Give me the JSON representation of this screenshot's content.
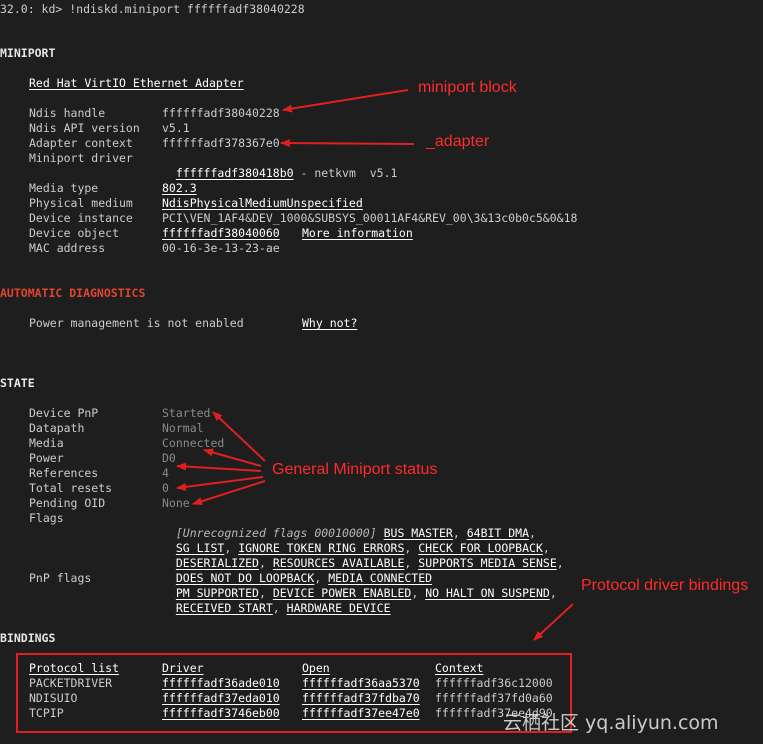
{
  "command": "32.0: kd> !ndiskd.miniport ffffffadf38040228",
  "miniport": {
    "header": "MINIPORT",
    "adapter_name": "Red Hat VirtIO Ethernet Adapter",
    "fields": {
      "ndis_handle": {
        "label": "Ndis handle",
        "value": "ffffffadf38040228"
      },
      "api_version": {
        "label": "Ndis API version",
        "value": "v5.1"
      },
      "adapter_context": {
        "label": "Adapter context",
        "value": "ffffffadf378367e0"
      },
      "miniport_driver": {
        "label": "Miniport driver",
        "value": "ffffffadf380418b0",
        "suffix": " - netkvm  v5.1"
      },
      "media_type": {
        "label": "Media type",
        "value": "802.3"
      },
      "physical_medium": {
        "label": "Physical medium",
        "value": "NdisPhysicalMediumUnspecified"
      },
      "device_instance": {
        "label": "Device instance",
        "value": "PCI\\VEN_1AF4&DEV_1000&SUBSYS_00011AF4&REV_00\\3&13c0b0c5&0&18"
      },
      "device_object": {
        "label": "Device object",
        "value": "ffffffadf38040060",
        "link": "More information"
      },
      "mac_address": {
        "label": "MAC address",
        "value": "00-16-3e-13-23-ae"
      }
    }
  },
  "diagnostics": {
    "header": "AUTOMATIC DIAGNOSTICS",
    "message": "Power management is not enabled",
    "link": "Why not?"
  },
  "state": {
    "header": "STATE",
    "device_pnp": {
      "label": "Device PnP",
      "value": "Started"
    },
    "datapath": {
      "label": "Datapath",
      "value": "Normal"
    },
    "media": {
      "label": "Media",
      "value": "Connected"
    },
    "power": {
      "label": "Power",
      "value": "D0"
    },
    "references": {
      "label": "References",
      "value": "4"
    },
    "total_resets": {
      "label": "Total resets",
      "value": "0"
    },
    "pending_oid": {
      "label": "Pending OID",
      "value": "None"
    },
    "flags": {
      "label": "Flags",
      "unrecognized": "[Unrecognized flags 00010000]",
      "items": [
        "BUS_MASTER",
        "64BIT_DMA",
        "SG_LIST",
        "IGNORE_TOKEN_RING_ERRORS",
        "CHECK_FOR_LOOPBACK",
        "DESERIALIZED",
        "RESOURCES_AVAILABLE",
        "SUPPORTS_MEDIA_SENSE",
        "DOES_NOT_DO_LOOPBACK",
        "MEDIA_CONNECTED"
      ]
    },
    "pnp_flags": {
      "label": "PnP flags",
      "items": [
        "PM_SUPPORTED",
        "DEVICE_POWER_ENABLED",
        "NO_HALT_ON_SUSPEND",
        "RECEIVED_START",
        "HARDWARE_DEVICE"
      ]
    },
    "comma": ","
  },
  "bindings": {
    "header": "BINDINGS",
    "columns": [
      "Protocol list",
      "Driver",
      "Open",
      "Context"
    ],
    "rows": [
      [
        "PACKETDRIVER",
        "ffffffadf36ade010",
        "ffffffadf36aa5370",
        "ffffffadf36c12000"
      ],
      [
        "NDISUIO",
        "ffffffadf37eda010",
        "ffffffadf37fdba70",
        "ffffffadf37fd0a60"
      ],
      [
        "TCPIP",
        "ffffffadf3746eb00",
        "ffffffadf37ee47e0",
        "ffffffadf37ee4d90"
      ]
    ]
  },
  "annotations": {
    "miniport_block": "miniport block",
    "adapter": "_adapter",
    "general_status": "General Miniport status",
    "protocol_bindings": "Protocol driver bindings"
  },
  "watermark": "云栖社区 yq.aliyun.com",
  "colors": {
    "background": "#1e1e1e",
    "text": "#cccccc",
    "link": "#ffffff",
    "diagnostics_header": "#e0442f",
    "annotation": "#ff2b2b"
  }
}
